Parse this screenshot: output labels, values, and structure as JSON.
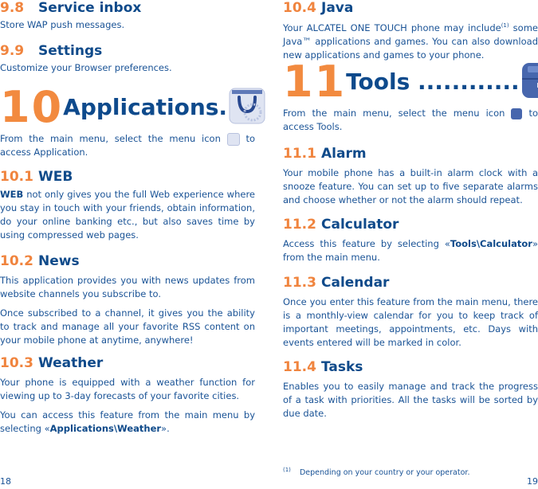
{
  "left_page": {
    "s98": {
      "num": "9.8",
      "title": "Service inbox",
      "body": "Store WAP push messages."
    },
    "s99": {
      "num": "9.9",
      "title": "Settings",
      "body": "Customize your Browser preferences."
    },
    "chapter": {
      "num": "10",
      "title": "Applications.",
      "icon": "shopping-bag-icon",
      "intro_before": "From the main menu, select the menu icon",
      "intro_after": "to access Application."
    },
    "s101": {
      "num": "10.1",
      "title": "WEB",
      "body_bold": "WEB",
      "body": " not only gives you the full Web experience where you stay in touch with your friends, obtain information, do your online banking etc., but also saves time by using compressed web pages."
    },
    "s102": {
      "num": "10.2",
      "title": "News",
      "body1": "This application provides you with news updates from website channels you subscribe to.",
      "body2": "Once subscribed to a channel, it gives you the ability to track and manage all your favorite RSS content on your mobile phone at anytime, anywhere!"
    },
    "s103": {
      "num": "10.3",
      "title": "Weather",
      "body1": "Your phone is equipped with a weather function for viewing up to 3-day forecasts of your favorite cities.",
      "body2_before": "You can access this feature from the main menu by selecting «",
      "body2_bold": "Applications\\Weather",
      "body2_after": "»."
    },
    "page_number": "18"
  },
  "right_page": {
    "s104": {
      "num": "10.4",
      "title": "Java",
      "body_before": "Your ALCATEL ONE TOUCH phone may include",
      "footnote_ref": "(1)",
      "body_after": " some Java™ applications and games. You can also download new applications and games to your phone."
    },
    "chapter": {
      "num": "11",
      "title": "Tools ............",
      "icon": "toolbox-icon",
      "intro_before": "From the main menu, select the menu icon",
      "intro_after": "to access Tools."
    },
    "s111": {
      "num": "11.1",
      "title": "Alarm",
      "body": "Your mobile phone has a built-in alarm clock with a snooze feature. You can set up to five separate alarms and choose whether or not the alarm should repeat."
    },
    "s112": {
      "num": "11.2",
      "title": "Calculator",
      "body_before": "Access this feature by selecting «",
      "body_bold": "Tools\\Calculator",
      "body_after": "» from the main menu."
    },
    "s113": {
      "num": "11.3",
      "title": "Calendar",
      "body": "Once you enter this feature from the main menu, there is a monthly-view calendar for you to keep track of important meetings, appointments, etc. Days with events entered will be marked in color."
    },
    "s114": {
      "num": "11.4",
      "title": "Tasks",
      "body": "Enables you to easily manage and track the progress of a task with priorities. All the tasks will be sorted by due date."
    },
    "footnote": {
      "mark": "(1)",
      "text": "Depending on your country or your operator."
    },
    "page_number": "19"
  },
  "colors": {
    "accent_orange": "#f0843e",
    "heading_blue": "#0f4a8a",
    "body_blue": "#1a5396"
  }
}
